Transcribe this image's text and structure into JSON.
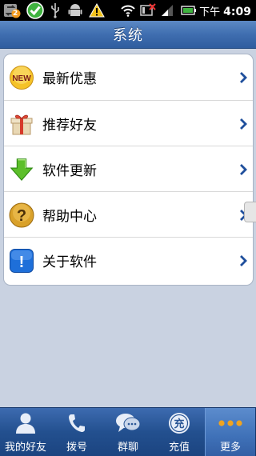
{
  "status_bar": {
    "ampm": "下午",
    "time": "4:09",
    "notification_badge": "2",
    "icons": [
      "sync-icon",
      "check-icon",
      "usb-icon",
      "android-icon",
      "warning-icon",
      "wifi-icon",
      "no-signal-icon",
      "signal-icon",
      "battery-icon"
    ]
  },
  "header": {
    "title": "系统"
  },
  "menu": {
    "items": [
      {
        "label": "最新优惠",
        "icon": "new-badge-icon",
        "icon_text": "NEW"
      },
      {
        "label": "推荐好友",
        "icon": "gift-icon"
      },
      {
        "label": "软件更新",
        "icon": "download-arrow-icon"
      },
      {
        "label": "帮助中心",
        "icon": "help-icon",
        "icon_text": "?"
      },
      {
        "label": "关于软件",
        "icon": "info-icon",
        "icon_text": "!"
      }
    ]
  },
  "tab_bar": {
    "tabs": [
      {
        "label": "我的好友",
        "icon": "person-icon",
        "active": false
      },
      {
        "label": "拨号",
        "icon": "phone-icon",
        "active": false
      },
      {
        "label": "群聊",
        "icon": "chat-bubble-icon",
        "active": false
      },
      {
        "label": "充值",
        "icon": "recharge-icon",
        "icon_text": "充",
        "active": false
      },
      {
        "label": "更多",
        "icon": "more-dots-icon",
        "active": true
      }
    ]
  },
  "colors": {
    "header_blue": "#3f6eb0",
    "tabbar_blue": "#23508f",
    "background": "#c9d2e1",
    "chevron_blue": "#1f4f9c",
    "dots_orange": "#f0a420"
  }
}
